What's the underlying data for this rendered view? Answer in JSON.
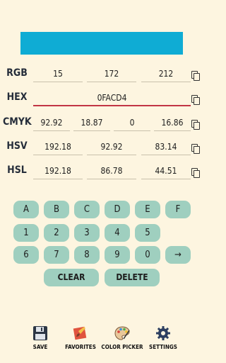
{
  "rows": {
    "rgb": {
      "label": "RGB",
      "r": "15",
      "g": "172",
      "b": "212"
    },
    "hex": {
      "label": "HEX",
      "value": "0FACD4"
    },
    "cmyk": {
      "label": "CMYK",
      "c": "92.92",
      "m": "18.87",
      "y": "0",
      "k": "16.86"
    },
    "hsv": {
      "label": "HSV",
      "h": "192.18",
      "s": "92.92",
      "v": "83.14"
    },
    "hsl": {
      "label": "HSL",
      "h": "192.18",
      "s": "86.78",
      "l": "44.51"
    }
  },
  "keys": {
    "a": "A",
    "b": "B",
    "c": "C",
    "d": "D",
    "e": "E",
    "f": "F",
    "k1": "1",
    "k2": "2",
    "k3": "3",
    "k4": "4",
    "k5": "5",
    "k6": "6",
    "k7": "7",
    "k8": "8",
    "k9": "9",
    "k0": "0",
    "arrow": "→",
    "clear": "CLEAR",
    "delete": "DELETE"
  },
  "nav": {
    "save": "SAVE",
    "favorites": "FAVORITES",
    "color_picker": "COLOR PICKER",
    "settings": "SETTINGS"
  },
  "colors": {
    "swatch": "#0facd4",
    "key": "#9fcfbf",
    "background": "#fdf5e0",
    "hex_underline": "#c23545"
  }
}
